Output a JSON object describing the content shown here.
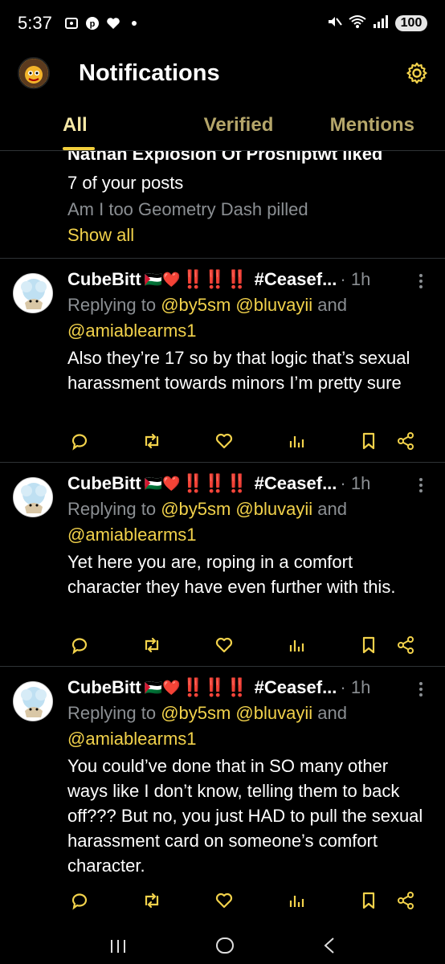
{
  "status_bar": {
    "time": "5:37",
    "battery": "100",
    "icons": [
      "screenshot-icon",
      "pinterest-icon",
      "heart-icon",
      "dot-icon",
      "mute-icon",
      "wifi-icon",
      "signal-icon"
    ]
  },
  "header": {
    "title": "Notifications"
  },
  "tabs": [
    {
      "label": "All",
      "active": true
    },
    {
      "label": "Verified",
      "active": false
    },
    {
      "label": "Mentions",
      "active": false
    }
  ],
  "liked_notification": {
    "partial_top": "Nathan Explosion Of Proshiptwt liked",
    "line2": "7 of your posts",
    "preview": "Am I too Geometry Dash pilled",
    "show_all": "Show all"
  },
  "posts": [
    {
      "author": "CubeBitt",
      "flag": "🇵🇸❤️",
      "badges": "‼️‼️‼️",
      "hashtag": "#Ceasef...",
      "time": "· 1h",
      "replying_prefix": "Replying to ",
      "mentions": "@by5sm @bluvayii",
      "and": " and",
      "mention2": "@amiablearms1",
      "text": "Also they’re 17 so by that logic that’s sexual harassment towards minors I’m pretty sure"
    },
    {
      "author": "CubeBitt",
      "flag": "🇵🇸❤️",
      "badges": "‼️‼️‼️",
      "hashtag": "#Ceasef...",
      "time": "· 1h",
      "replying_prefix": "Replying to ",
      "mentions": "@by5sm @bluvayii",
      "and": " and",
      "mention2": "@amiablearms1",
      "text": "Yet here you are, roping in a comfort character they have even further with this."
    },
    {
      "author": "CubeBitt",
      "flag": "🇵🇸❤️",
      "badges": "‼️‼️‼️",
      "hashtag": "#Ceasef...",
      "time": "· 1h",
      "replying_prefix": "Replying to ",
      "mentions": "@by5sm @bluvayii",
      "and": " and",
      "mention2": "@amiablearms1",
      "text": "You could’ve done that in SO many other ways like I don’t know, telling them to back off??? But no, you just HAD to pull the sexual harassment card on someone’s comfort character."
    }
  ],
  "colors": {
    "accent": "#f2d24b",
    "muted": "#8b8f93",
    "background": "#000000"
  }
}
